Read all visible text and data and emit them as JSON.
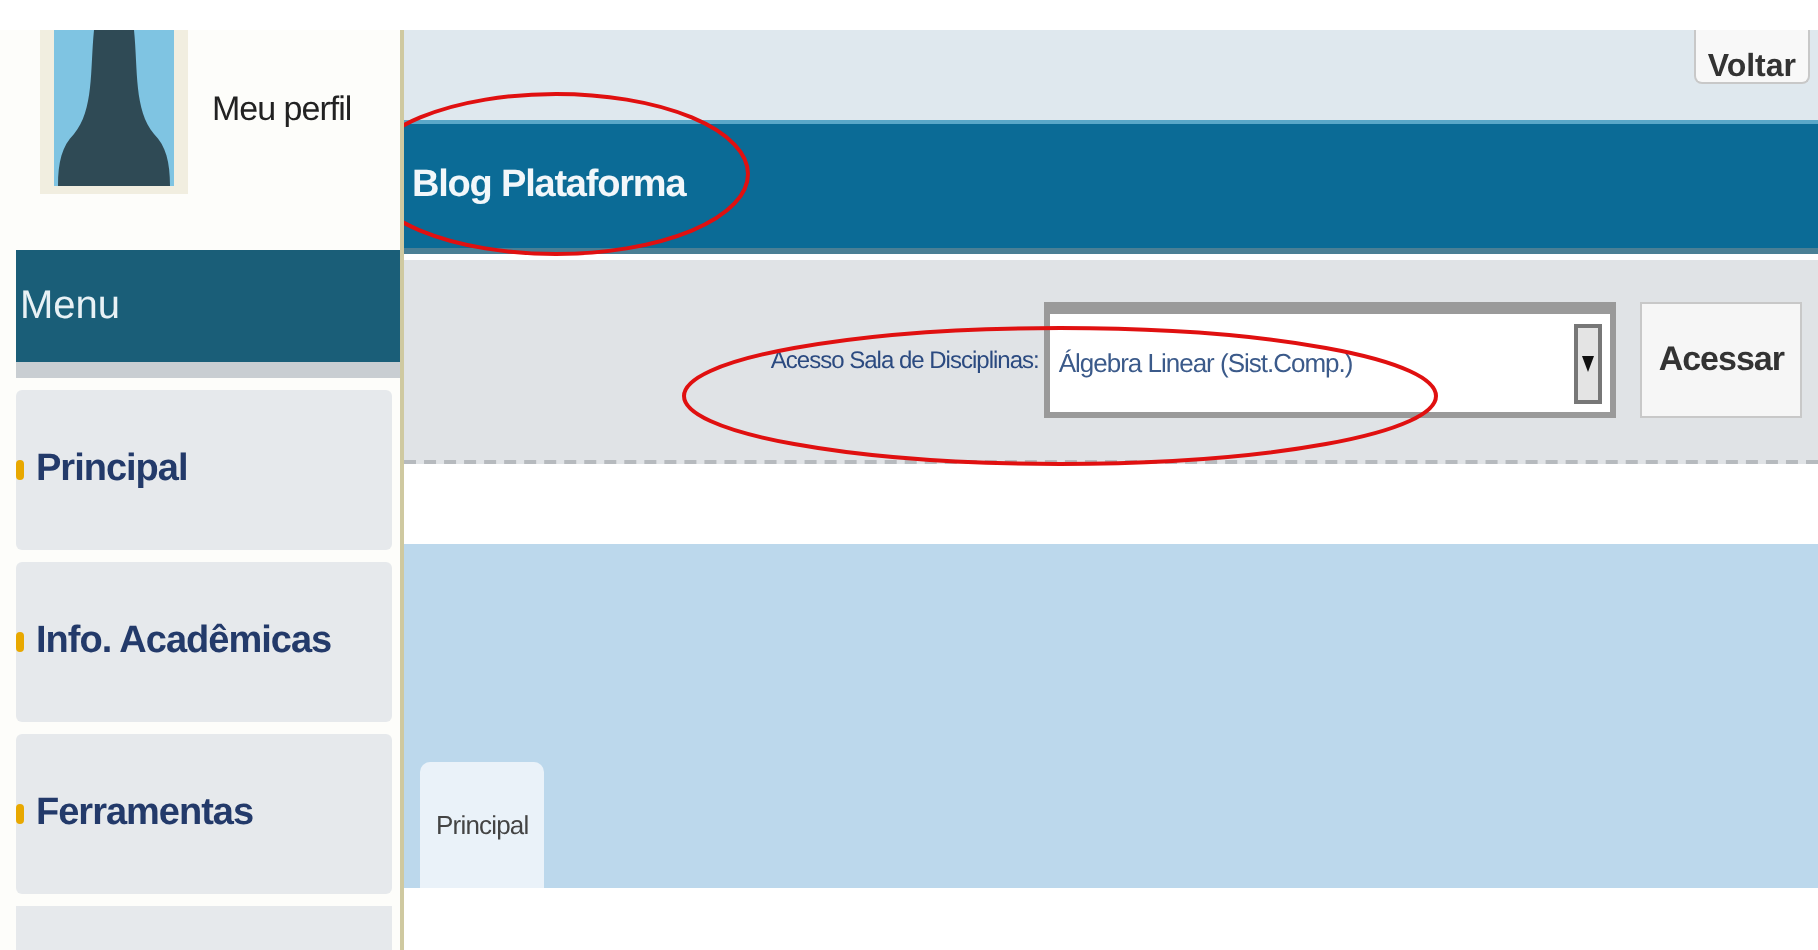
{
  "profile": {
    "label": "Meu perfil"
  },
  "sidebar": {
    "title": "Menu",
    "items": [
      {
        "kind": "link",
        "label": "Principal"
      },
      {
        "kind": "link",
        "label": "Info. Acadêmicas"
      },
      {
        "kind": "link",
        "label": "Ferramentas"
      },
      {
        "kind": "blank"
      }
    ]
  },
  "top": {
    "back_button": "Voltar"
  },
  "header": {
    "title": "Blog Plataforma",
    "circled": true
  },
  "access": {
    "label": "Acesso Sala de Disciplinas:",
    "value": "Álgebra Linear (Sist.Comp.)",
    "button": "Acessar",
    "circled": true
  },
  "tabs": [
    {
      "label": "Principal",
      "selected": true
    }
  ]
}
